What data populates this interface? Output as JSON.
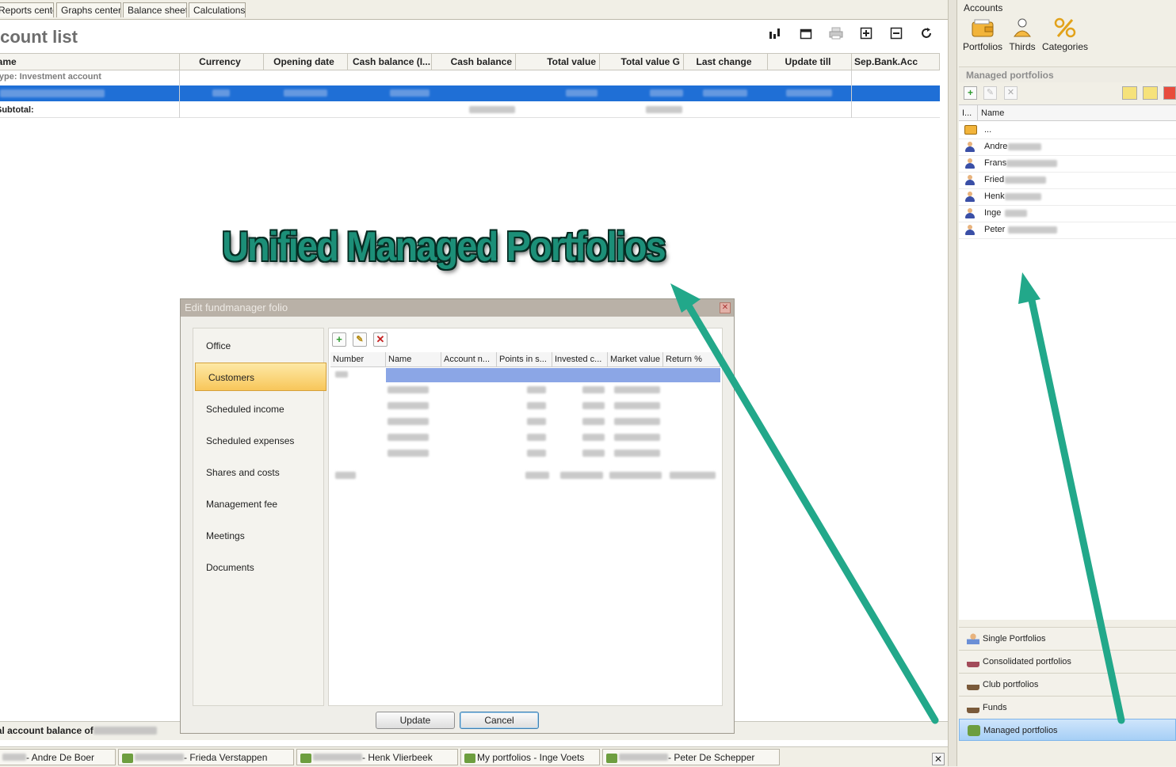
{
  "tabs": [
    "Reports center",
    "Graphs center",
    "Balance sheet",
    "Calculations"
  ],
  "page_title": "Account list",
  "columns": [
    "Name",
    "Currency",
    "Opening date",
    "Cash balance (I...",
    "Cash balance",
    "Total value",
    "Total value G",
    "Last change",
    "Update till",
    "Sep.Bank.Acc"
  ],
  "group_row": "Type: Investment account",
  "subtotal_label": "Subtotal:",
  "footer_label": "Total account balance of",
  "taskbar": [
    "- Andre De Boer",
    "- Frieda Verstappen",
    "- Henk Vlierbeek",
    "My portfolios - Inge Voets",
    "- Peter De Schepper"
  ],
  "headline": "Unified Managed Portfolios",
  "dialog": {
    "title": "Edit fundmanager folio",
    "nav": [
      "Office",
      "Customers",
      "Scheduled income",
      "Scheduled expenses",
      "Shares and costs",
      "Management fee",
      "Meetings",
      "Documents"
    ],
    "active_nav": "Customers",
    "grid_columns": [
      "Number",
      "Name",
      "Account n...",
      "Points in s...",
      "Invested c...",
      "Market value",
      "Return %"
    ],
    "update_label": "Update",
    "cancel_label": "Cancel"
  },
  "right_panel": {
    "section_label": "Accounts",
    "big_buttons": [
      "Portfolios",
      "Thirds",
      "Categories"
    ],
    "managed_header": "Managed portfolios",
    "grid_columns": [
      "I...",
      "Name"
    ],
    "first_row": "...",
    "people": [
      "Andre",
      "Frans",
      "Fried",
      "Henk",
      "Inge",
      "Peter"
    ],
    "nav": [
      "Single Portfolios",
      "Consolidated portfolios",
      "Club portfolios",
      "Funds",
      "Managed portfolios"
    ],
    "active_nav": "Managed portfolios"
  },
  "colors": {
    "selection": "#1f6fd6",
    "accent_arrow": "#22a88a",
    "headline": "#1c8f78"
  }
}
